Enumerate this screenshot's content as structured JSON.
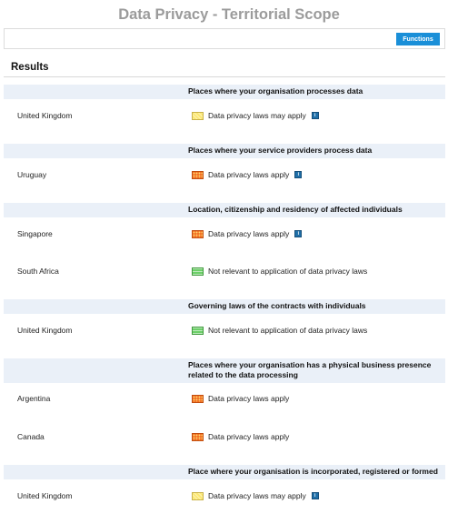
{
  "page": {
    "title": "Data Privacy - Territorial Scope"
  },
  "toolbar": {
    "functions_label": "Functions"
  },
  "results": {
    "title": "Results",
    "sections": [
      {
        "header": "Places where your organisation processes data",
        "rows": [
          {
            "place": "United Kingdom",
            "status": "Data privacy laws may apply",
            "swatch": "yellow",
            "info": true
          }
        ]
      },
      {
        "header": "Places where your service providers process data",
        "rows": [
          {
            "place": "Uruguay",
            "status": "Data privacy laws apply",
            "swatch": "red",
            "info": true
          }
        ]
      },
      {
        "header": "Location, citizenship and residency of affected individuals",
        "rows": [
          {
            "place": "Singapore",
            "status": "Data privacy laws apply",
            "swatch": "red",
            "info": true
          },
          {
            "place": "South Africa",
            "status": "Not relevant to application of data privacy laws",
            "swatch": "green",
            "info": false
          }
        ]
      },
      {
        "header": "Governing laws of the contracts with individuals",
        "rows": [
          {
            "place": "United Kingdom",
            "status": "Not relevant to application of data privacy laws",
            "swatch": "green",
            "info": false
          }
        ]
      },
      {
        "header_line1": "Places where your organisation has a physical business presence",
        "header_line2": "related to the data processing",
        "rows": [
          {
            "place": "Argentina",
            "status": "Data privacy laws apply",
            "swatch": "red",
            "info": false
          },
          {
            "place": "Canada",
            "status": "Data privacy laws apply",
            "swatch": "red",
            "info": false
          }
        ]
      },
      {
        "header": "Place where your organisation is incorporated, registered or formed",
        "rows": [
          {
            "place": "United Kingdom",
            "status": "Data privacy laws may apply",
            "swatch": "yellow",
            "info": true
          }
        ]
      }
    ]
  },
  "info_glyph": "i",
  "colors": {
    "accent": "#1a8fd8",
    "header_bg": "#eaf0f8",
    "may_apply": "#fce873",
    "apply": "#f26b21",
    "not_relevant": "#6ccf68"
  }
}
